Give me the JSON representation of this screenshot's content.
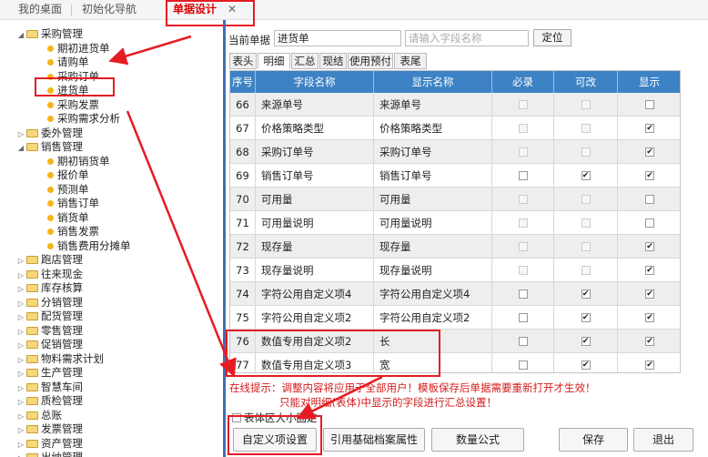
{
  "tabs": {
    "desktop": "我的桌面",
    "init_nav": "初始化导航",
    "doc_design": "单据设计",
    "close_glyph": "✕"
  },
  "tree": [
    {
      "label": "采购管理",
      "type": "folder",
      "expanded": true
    },
    {
      "label": "期初进货单",
      "type": "leaf"
    },
    {
      "label": "请购单",
      "type": "leaf"
    },
    {
      "label": "采购订单",
      "type": "leaf"
    },
    {
      "label": "进货单",
      "type": "leaf",
      "selected": true
    },
    {
      "label": "采购发票",
      "type": "leaf"
    },
    {
      "label": "采购需求分析",
      "type": "leaf"
    },
    {
      "label": "委外管理",
      "type": "folder",
      "expanded": false
    },
    {
      "label": "销售管理",
      "type": "folder",
      "expanded": true
    },
    {
      "label": "期初销货单",
      "type": "leaf"
    },
    {
      "label": "报价单",
      "type": "leaf"
    },
    {
      "label": "预测单",
      "type": "leaf"
    },
    {
      "label": "销售订单",
      "type": "leaf"
    },
    {
      "label": "销货单",
      "type": "leaf"
    },
    {
      "label": "销售发票",
      "type": "leaf"
    },
    {
      "label": "销售费用分摊单",
      "type": "leaf"
    },
    {
      "label": "跑店管理",
      "type": "folder",
      "expanded": false
    },
    {
      "label": "往来现金",
      "type": "folder",
      "expanded": false
    },
    {
      "label": "库存核算",
      "type": "folder",
      "expanded": false
    },
    {
      "label": "分销管理",
      "type": "folder",
      "expanded": false
    },
    {
      "label": "配货管理",
      "type": "folder",
      "expanded": false
    },
    {
      "label": "零售管理",
      "type": "folder",
      "expanded": false
    },
    {
      "label": "促销管理",
      "type": "folder",
      "expanded": false
    },
    {
      "label": "物料需求计划",
      "type": "folder",
      "expanded": false
    },
    {
      "label": "生产管理",
      "type": "folder",
      "expanded": false
    },
    {
      "label": "智慧车间",
      "type": "folder",
      "expanded": false
    },
    {
      "label": "质检管理",
      "type": "folder",
      "expanded": false
    },
    {
      "label": "总账",
      "type": "folder",
      "expanded": false
    },
    {
      "label": "发票管理",
      "type": "folder",
      "expanded": false
    },
    {
      "label": "资产管理",
      "type": "folder",
      "expanded": false
    },
    {
      "label": "出纳管理",
      "type": "folder",
      "expanded": false
    }
  ],
  "toolbar": {
    "current_doc_label": "当前单据",
    "current_doc_value": "进货单",
    "search_placeholder": "请输入字段名称",
    "locate_label": "定位"
  },
  "subtabs": [
    "表头",
    "明细",
    "汇总",
    "现结",
    "使用预付",
    "表尾"
  ],
  "active_subtab": "明细",
  "grid": {
    "headers": [
      "序号",
      "字段名称",
      "显示名称",
      "必录",
      "可改",
      "显示"
    ],
    "rows": [
      {
        "no": "66",
        "name": "来源单号",
        "display": "来源单号",
        "required": false,
        "editable": false,
        "show": false,
        "req_dis": true,
        "edit_dis": true
      },
      {
        "no": "67",
        "name": "价格策略类型",
        "display": "价格策略类型",
        "required": false,
        "editable": false,
        "show": true,
        "req_dis": true,
        "edit_dis": true
      },
      {
        "no": "68",
        "name": "采购订单号",
        "display": "采购订单号",
        "required": false,
        "editable": false,
        "show": true,
        "req_dis": true,
        "edit_dis": true
      },
      {
        "no": "69",
        "name": "销售订单号",
        "display": "销售订单号",
        "required": false,
        "editable": true,
        "show": true,
        "req_dis": false,
        "edit_dis": false
      },
      {
        "no": "70",
        "name": "可用量",
        "display": "可用量",
        "required": false,
        "editable": false,
        "show": false,
        "req_dis": true,
        "edit_dis": true
      },
      {
        "no": "71",
        "name": "可用量说明",
        "display": "可用量说明",
        "required": false,
        "editable": false,
        "show": false,
        "req_dis": true,
        "edit_dis": true
      },
      {
        "no": "72",
        "name": "现存量",
        "display": "现存量",
        "required": false,
        "editable": false,
        "show": true,
        "req_dis": true,
        "edit_dis": true
      },
      {
        "no": "73",
        "name": "现存量说明",
        "display": "现存量说明",
        "required": false,
        "editable": false,
        "show": true,
        "req_dis": true,
        "edit_dis": true
      },
      {
        "no": "74",
        "name": "字符公用自定义项4",
        "display": "字符公用自定义项4",
        "required": false,
        "editable": true,
        "show": true,
        "req_dis": false,
        "edit_dis": false
      },
      {
        "no": "75",
        "name": "字符公用自定义项2",
        "display": "字符公用自定义项2",
        "required": false,
        "editable": true,
        "show": true,
        "req_dis": false,
        "edit_dis": false
      },
      {
        "no": "76",
        "name": "数值专用自定义项2",
        "display": "长",
        "required": false,
        "editable": true,
        "show": true,
        "req_dis": false,
        "edit_dis": false
      },
      {
        "no": "77",
        "name": "数值专用自定义项3",
        "display": "宽",
        "required": false,
        "editable": true,
        "show": true,
        "req_dis": false,
        "edit_dis": false
      }
    ]
  },
  "hint": {
    "line1": "在线提示：调整内容将应用于全部用户！模板保存后单据需要重新打开才生效！",
    "line2": "只能对明细(表体)中显示的字段进行汇总设置！"
  },
  "fix_size_label": "表体区大小固定",
  "buttons": {
    "custom": "自定义项设置",
    "ref": "引用基础档案属性",
    "qty": "数量公式",
    "save": "保存",
    "exit": "退出"
  },
  "colors": {
    "header_bg": "#3d82c4",
    "annotation_red": "#e51c23",
    "hint_red": "#d41b1b",
    "splitter": "#3f6fb5"
  }
}
